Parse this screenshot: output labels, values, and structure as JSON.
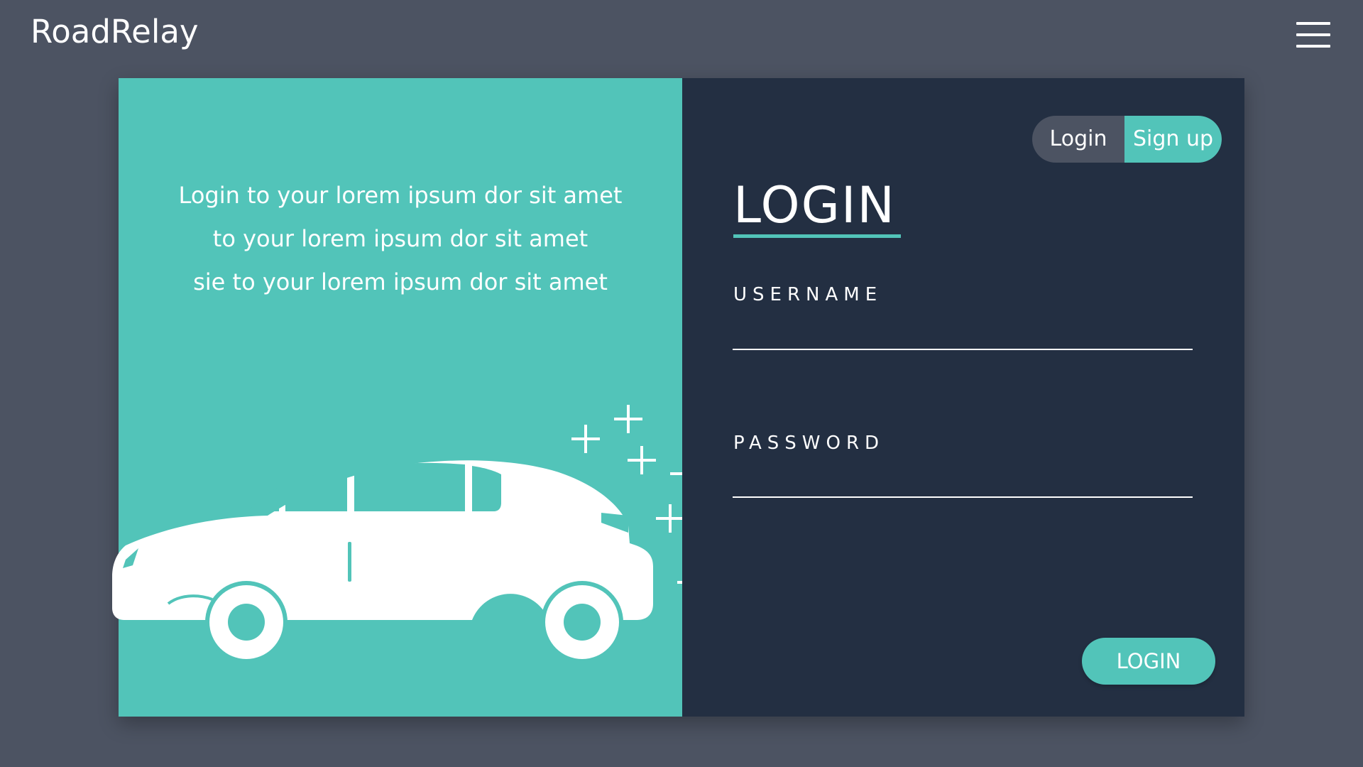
{
  "app": {
    "brand": "RoadRelay"
  },
  "header": {
    "menu_icon": "hamburger-menu-icon"
  },
  "hero": {
    "lines": [
      "Login to your lorem ipsum dor sit amet",
      "to your lorem ipsum dor sit amet",
      "sie to your lorem ipsum dor sit amet"
    ],
    "illustration_icon": "car-icon",
    "sparkle_icon": "plus-sparkle-icon"
  },
  "auth_toggle": {
    "login_label": "Login",
    "signup_label": "Sign up",
    "active": "Sign up"
  },
  "form": {
    "title": "LOGIN",
    "username_label": "USERNAME",
    "username_value": "",
    "password_label": "PASSWORD",
    "password_value": "",
    "submit_label": "LOGIN"
  },
  "colors": {
    "background": "#4c5362",
    "accent": "#52c4b9",
    "panel_dark": "#232f42",
    "text": "#ffffff"
  }
}
